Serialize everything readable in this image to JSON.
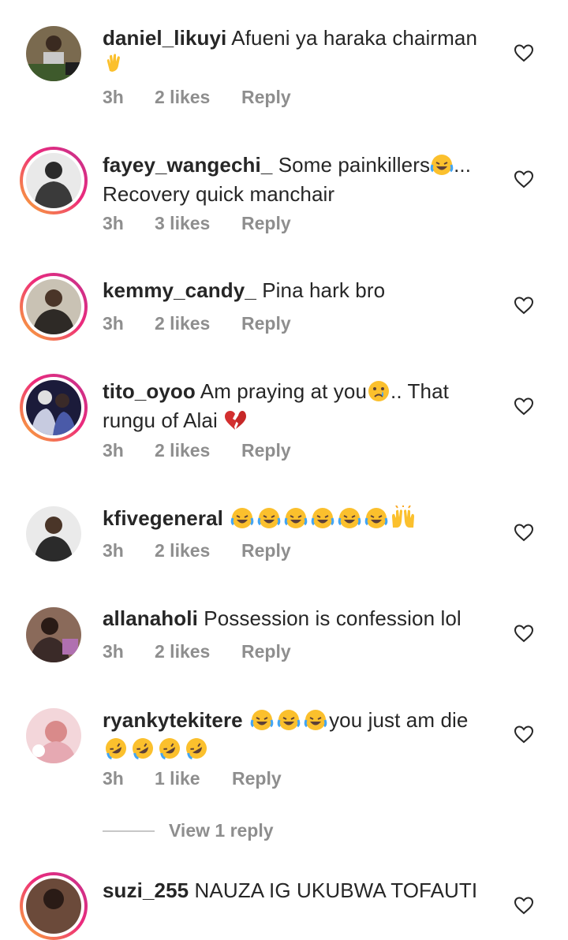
{
  "comments": [
    {
      "username": "daniel_likuyi",
      "text": "Afueni ya haraka chairman",
      "emoji_after": [
        "wave"
      ],
      "time": "3h",
      "likes": "2 likes",
      "reply": "Reply",
      "avatar_style": "plain",
      "avatar_colors": [
        "#7a6a4f",
        "#3e5a2c"
      ]
    },
    {
      "username": "fayey_wangechi_",
      "text": "Some painkillers",
      "text_after_emoji": "... Recovery quick manchair",
      "emoji_inline": [
        "laugh"
      ],
      "time": "3h",
      "likes": "3 likes",
      "reply": "Reply",
      "avatar_style": "story",
      "avatar_colors": [
        "#e9e9e9",
        "#3a3a3a"
      ]
    },
    {
      "username": "kemmy_candy_",
      "text": "Pina hark bro",
      "time": "3h",
      "likes": "2 likes",
      "reply": "Reply",
      "avatar_style": "story",
      "avatar_colors": [
        "#c9c2b4",
        "#2e2a26"
      ]
    },
    {
      "username": "tito_oyoo",
      "text": "Am praying at you",
      "text_after_emoji": ".. That rungu of Alai",
      "emoji_inline": [
        "cry"
      ],
      "emoji_after": [
        "broken-heart"
      ],
      "time": "3h",
      "likes": "2 likes",
      "reply": "Reply",
      "avatar_style": "story",
      "avatar_colors": [
        "#4a5aa8",
        "#1b1b3a"
      ]
    },
    {
      "username": "kfivegeneral",
      "text": "",
      "emoji_after": [
        "laugh",
        "laugh",
        "laugh",
        "laugh",
        "laugh",
        "laugh",
        "raised-hands"
      ],
      "time": "3h",
      "likes": "2 likes",
      "reply": "Reply",
      "avatar_style": "plain",
      "avatar_colors": [
        "#eaeaea",
        "#2b2b2b"
      ]
    },
    {
      "username": "allanaholi",
      "text": "Possession is confession lol",
      "time": "3h",
      "likes": "2 likes",
      "reply": "Reply",
      "avatar_style": "plain",
      "avatar_colors": [
        "#8a6a5a",
        "#3a2a28"
      ]
    },
    {
      "username": "ryankytekitere",
      "text": "",
      "text_after_emoji": "you just am die",
      "emoji_inline": [
        "laugh",
        "laugh",
        "laugh"
      ],
      "emoji_after": [
        "rofl",
        "rofl",
        "rofl",
        "rofl"
      ],
      "time": "3h",
      "likes": "1 like",
      "reply": "Reply",
      "avatar_style": "plain",
      "avatar_colors": [
        "#e6a9b2",
        "#d98a8a"
      ]
    },
    {
      "username": "suzi_255",
      "text": "NAUZA IG UKUBWA TOFAUTI",
      "avatar_style": "story",
      "avatar_colors": [
        "#6b4a3a",
        "#2a1b16"
      ]
    }
  ],
  "view_replies": "View 1 reply",
  "colors": {
    "meta": "#8e8e8e",
    "text": "#262626",
    "ring_start": "#f9b233",
    "ring_end": "#c1338e"
  },
  "icons": {
    "like": "heart-outline-icon"
  }
}
